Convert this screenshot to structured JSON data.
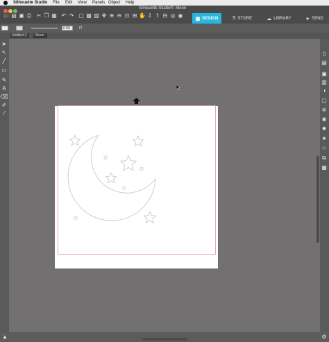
{
  "menubar": {
    "app_name": "Silhouette Studio",
    "items": [
      "File",
      "Edit",
      "View",
      "Panels",
      "Object",
      "Help"
    ]
  },
  "window": {
    "title": "Silhouette Studio®: Moon"
  },
  "tabs": [
    {
      "label": "DESIGN",
      "icon": "design-icon",
      "active": true
    },
    {
      "label": "STORE",
      "icon": "store-icon",
      "active": false
    },
    {
      "label": "LIBRARY",
      "icon": "library-icon",
      "active": false
    },
    {
      "label": "SEND",
      "icon": "send-icon",
      "active": false
    }
  ],
  "properties": {
    "line_width_value": "0.00",
    "line_width_unit": "pt"
  },
  "documents": [
    {
      "label": "Untitled-1"
    },
    {
      "label": "Moon"
    }
  ],
  "colors": {
    "accent": "#26b6e0",
    "canvas_bg": "#727070",
    "cut_border": "#f2a3ad",
    "design_stroke": "#c8c8c8"
  },
  "icons": {
    "left_toolbar": [
      "select-icon",
      "point-edit-icon",
      "line-icon",
      "rectangle-icon",
      "pencil-icon",
      "text-icon",
      "eraser-icon",
      "knife-icon",
      "eyedropper-icon"
    ],
    "right_toolbar": [
      "page-setup-icon",
      "send-icon",
      "fill-icon",
      "line-style-icon",
      "transparency-icon",
      "offset-icon",
      "trace-icon",
      "replicate-icon",
      "modify-icon",
      "star-icon",
      "star-outline-icon",
      "library-icon",
      "design-store-icon"
    ]
  }
}
